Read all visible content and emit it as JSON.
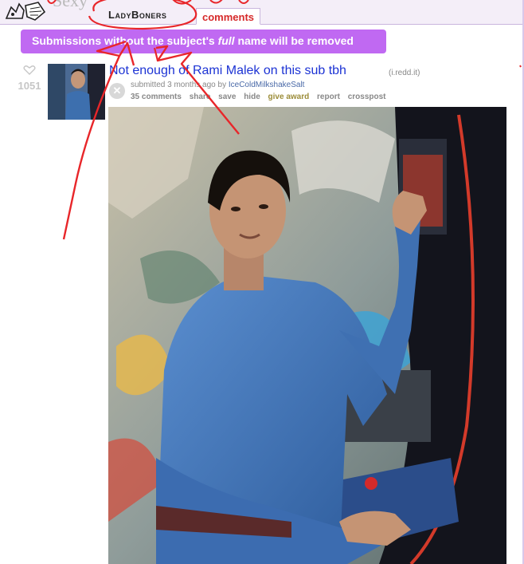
{
  "header": {
    "subreddit_title": "LadyBoners",
    "logo_title_partial": "Sexy",
    "active_tab": "comments"
  },
  "announcement": {
    "before": "Submissions without the subject's ",
    "emphasis": "full",
    "after": " name will be removed",
    "background": "#c069f2"
  },
  "post": {
    "score": "1051",
    "title": "Not enough of Rami Malek on this sub tbh",
    "domain": "(i.redd.it)",
    "tagline_prefix": "submitted 3 months ago by ",
    "author": "IceColdMilkshakeSalt",
    "buttons": {
      "comments": "35 comments",
      "share": "share",
      "save": "save",
      "hide": "hide",
      "give_award": "give award",
      "report": "report",
      "crosspost": "crosspost"
    }
  },
  "colors": {
    "title_link": "#1c33d4",
    "annotation_red": "#e8262a",
    "tab_active": "#d62a2a"
  },
  "icons": [
    "upvote-heart-icon",
    "close-circle-icon",
    "alien-logo"
  ]
}
